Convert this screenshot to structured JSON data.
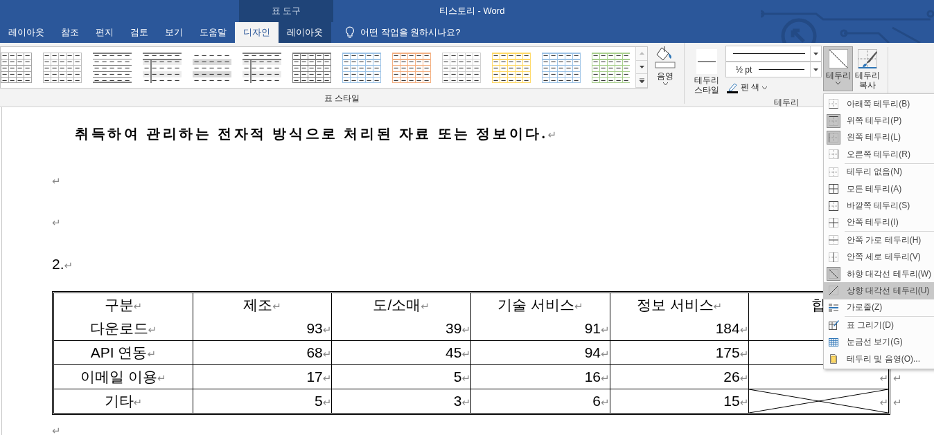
{
  "title_bar": {
    "context_label": "표 도구",
    "title": "티스토리 - Word"
  },
  "tabs": [
    {
      "label": "레이아웃",
      "selected": false,
      "contextual": false
    },
    {
      "label": "참조",
      "selected": false,
      "contextual": false
    },
    {
      "label": "편지",
      "selected": false,
      "contextual": false
    },
    {
      "label": "검토",
      "selected": false,
      "contextual": false
    },
    {
      "label": "보기",
      "selected": false,
      "contextual": false
    },
    {
      "label": "도움말",
      "selected": false,
      "contextual": false
    },
    {
      "label": "디자인",
      "selected": true,
      "contextual": true
    },
    {
      "label": "레이아웃",
      "selected": false,
      "contextual": true
    }
  ],
  "tell_me": {
    "text": "어떤 작업을 원하시나요?"
  },
  "ribbon": {
    "styles": [
      {
        "kind": "grid",
        "color": "#a6a6a6"
      },
      {
        "kind": "grid",
        "color": "#bfbfbf"
      },
      {
        "kind": "rules",
        "color": "#7f7f7f"
      },
      {
        "kind": "banded-split",
        "color": "#7f7f7f"
      },
      {
        "kind": "banded",
        "color": "#d9d9d9"
      },
      {
        "kind": "banded-split",
        "color": "#7f7f7f"
      },
      {
        "kind": "grid-header",
        "color": "#7f7f7f"
      },
      {
        "kind": "grid-header",
        "color": "#9dc3e6"
      },
      {
        "kind": "grid-header",
        "color": "#f4b183"
      },
      {
        "kind": "grid",
        "color": "#d0d0d0"
      },
      {
        "kind": "grid-header",
        "color": "#ffd966"
      },
      {
        "kind": "grid-header",
        "color": "#9dc3e6"
      },
      {
        "kind": "grid-header",
        "color": "#a9d08e"
      }
    ],
    "shading_label": "음영",
    "styles_group_label": "표 스타일",
    "border_style_label": "테두리 스타일",
    "pen_weight": "½ pt",
    "pen_color_label": "펜 색",
    "borders_label": "테두리",
    "borders_expanded": true,
    "border_painter_label": "테두리 복사",
    "borders_group_label": "테두리"
  },
  "document": {
    "paragraphs": [
      {
        "kind": "bold",
        "text": "취득하여 관리하는 전자적 방식으로 처리된 자료 또는 정보이다.",
        "mark": "↵"
      },
      {
        "kind": "empty",
        "mark": "↵"
      },
      {
        "kind": "empty",
        "mark": "↵"
      },
      {
        "kind": "plain",
        "text": "2.",
        "mark": "↵"
      }
    ],
    "table": {
      "header": [
        {
          "text": "구분",
          "mark": "↵"
        },
        {
          "text": "제조",
          "mark": "↵"
        },
        {
          "text": "도/소매",
          "mark": "↵"
        },
        {
          "text": "기술 서비스",
          "mark": "↵"
        },
        {
          "text": "정보 서비스",
          "mark": "↵"
        },
        {
          "text": "합"
        }
      ],
      "rows": [
        {
          "cells": [
            {
              "text": "다운로드",
              "mark": "↵"
            },
            {
              "text": "93",
              "mark": "↵"
            },
            {
              "text": "39",
              "mark": "↵"
            },
            {
              "text": "91",
              "mark": "↵"
            },
            {
              "text": "184",
              "mark": "↵"
            },
            {}
          ]
        },
        {
          "cells": [
            {
              "text": "API 연동",
              "mark": "↵"
            },
            {
              "text": "68",
              "mark": "↵"
            },
            {
              "text": "45",
              "mark": "↵"
            },
            {
              "text": "94",
              "mark": "↵"
            },
            {
              "text": "175",
              "mark": "↵"
            },
            {}
          ]
        },
        {
          "cells": [
            {
              "text": "이메일 이용",
              "mark": "↵"
            },
            {
              "text": "17",
              "mark": "↵"
            },
            {
              "text": "5",
              "mark": "↵"
            },
            {
              "text": "16",
              "mark": "↵"
            },
            {
              "text": "26",
              "mark": "↵"
            },
            {
              "mark": "↵"
            }
          ],
          "end_mark": "↵"
        },
        {
          "cells": [
            {
              "text": "기타",
              "mark": "↵"
            },
            {
              "text": "5",
              "mark": "↵"
            },
            {
              "text": "3",
              "mark": "↵"
            },
            {
              "text": "6",
              "mark": "↵"
            },
            {
              "text": "15",
              "mark": "↵"
            },
            {
              "mark": "↵",
              "diagonals": true
            }
          ],
          "end_mark": "↵"
        }
      ]
    },
    "after_mark": "↵"
  },
  "menu": {
    "groups": [
      [
        {
          "label": "아래쪽 테두리(B)",
          "checked": false,
          "selected": false
        },
        {
          "label": "위쪽 테두리(P)",
          "checked": true,
          "selected": false
        },
        {
          "label": "왼쪽 테두리(L)",
          "checked": true,
          "selected": false
        },
        {
          "label": "오른쪽 테두리(R)",
          "checked": false,
          "selected": false
        }
      ],
      [
        {
          "label": "테두리 없음(N)",
          "checked": false,
          "selected": false
        },
        {
          "label": "모든 테두리(A)",
          "checked": false,
          "selected": false
        },
        {
          "label": "바깥쪽 테두리(S)",
          "checked": false,
          "selected": false
        },
        {
          "label": "안쪽 테두리(I)",
          "checked": false,
          "selected": false
        }
      ],
      [
        {
          "label": "안쪽 가로 테두리(H)",
          "checked": false,
          "selected": false
        },
        {
          "label": "안쪽 세로 테두리(V)",
          "checked": false,
          "selected": false
        },
        {
          "label": "하향 대각선 테두리(W)",
          "checked": true,
          "selected": false
        },
        {
          "label": "상향 대각선 테두리(U)",
          "checked": false,
          "selected": true
        },
        {
          "label": "가로줄(Z)",
          "checked": false,
          "selected": false
        }
      ],
      [
        {
          "label": "표 그리기(D)",
          "checked": false,
          "selected": false
        },
        {
          "label": "눈금선 보기(G)",
          "checked": false,
          "selected": false
        },
        {
          "label": "테두리 및 음영(O)...",
          "checked": false,
          "selected": false
        }
      ]
    ]
  }
}
